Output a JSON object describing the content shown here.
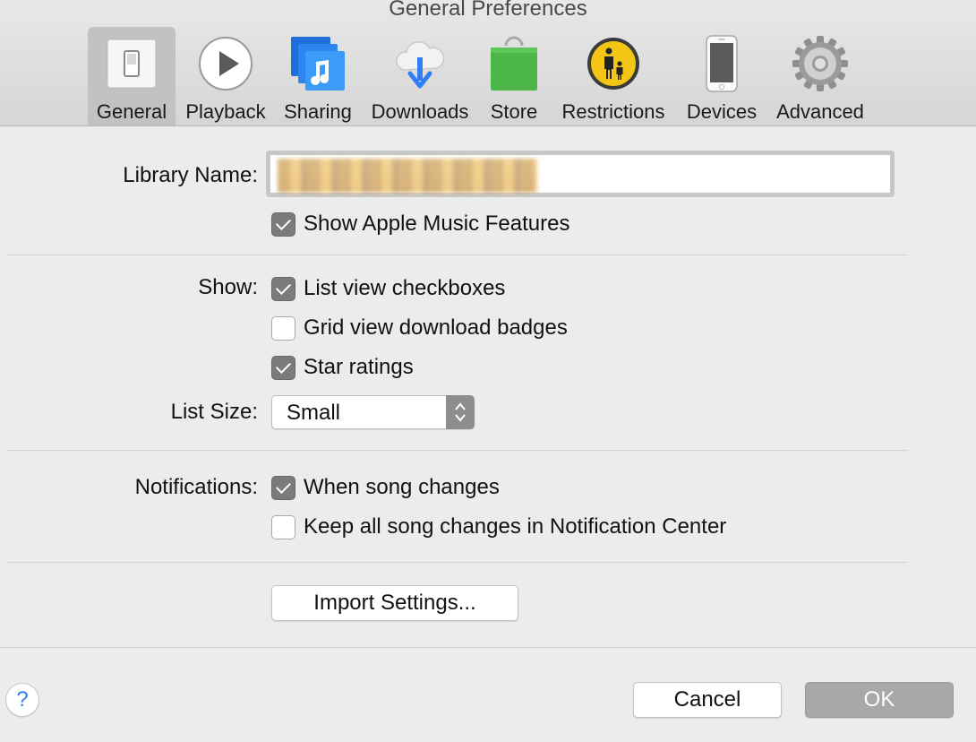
{
  "window": {
    "title": "General Preferences"
  },
  "toolbar": {
    "tabs": [
      {
        "label": "General",
        "icon": "switch-icon",
        "selected": true
      },
      {
        "label": "Playback",
        "icon": "play-icon",
        "selected": false
      },
      {
        "label": "Sharing",
        "icon": "music-note-icon",
        "selected": false
      },
      {
        "label": "Downloads",
        "icon": "cloud-download-icon",
        "selected": false
      },
      {
        "label": "Store",
        "icon": "shopping-bag-icon",
        "selected": false
      },
      {
        "label": "Restrictions",
        "icon": "parental-icon",
        "selected": false
      },
      {
        "label": "Devices",
        "icon": "iphone-icon",
        "selected": false
      },
      {
        "label": "Advanced",
        "icon": "gear-icon",
        "selected": false
      }
    ]
  },
  "library": {
    "label": "Library Name:",
    "value": "S"
  },
  "apple_music": {
    "label": "Show Apple Music Features",
    "checked": true
  },
  "show": {
    "label": "Show:",
    "options": [
      {
        "label": "List view checkboxes",
        "checked": true
      },
      {
        "label": "Grid view download badges",
        "checked": false
      },
      {
        "label": "Star ratings",
        "checked": true
      }
    ]
  },
  "list_size": {
    "label": "List Size:",
    "value": "Small"
  },
  "notifications": {
    "label": "Notifications:",
    "options": [
      {
        "label": "When song changes",
        "checked": true
      },
      {
        "label": "Keep all song changes in Notification Center",
        "checked": false
      }
    ]
  },
  "import_button": "Import Settings...",
  "footer": {
    "help": "?",
    "cancel": "Cancel",
    "ok": "OK"
  },
  "colors": {
    "accent": "#2f7ef6",
    "checkbox_on": "#7b7b7b",
    "default_button": "#a8a8a8",
    "store_green": "#4cb748",
    "restrictions_yellow": "#f1c40f"
  }
}
